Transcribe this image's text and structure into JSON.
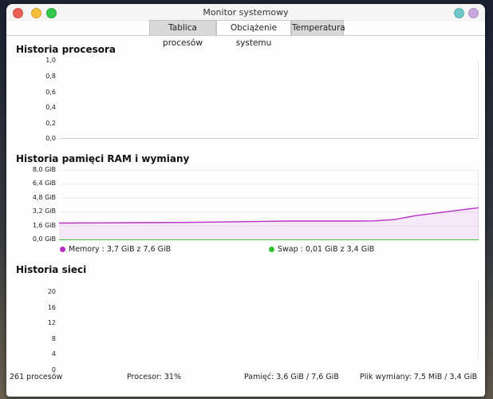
{
  "window": {
    "title": "Monitor systemowy",
    "controls_right": [
      {
        "name": "teal",
        "color": "#6cc7c9"
      },
      {
        "name": "purple",
        "color": "#c9a6db"
      }
    ]
  },
  "tabs": [
    {
      "label": "Tablica procesów",
      "active": false
    },
    {
      "label": "Obciążenie systemu",
      "active": true
    },
    {
      "label": "Temperatura",
      "active": false
    }
  ],
  "cpu": {
    "title": "Historia procesora",
    "ticks": [
      "1,0",
      "0,8",
      "0,6",
      "0,4",
      "0,2",
      "0,0"
    ]
  },
  "memory": {
    "title": "Historia pamięci RAM i wymiany",
    "ticks": [
      "8,0 GiB",
      "6,4 GiB",
      "4,8 GiB",
      "3,2 GiB",
      "1,6 GiB",
      "0,0 GiB"
    ],
    "legend": [
      {
        "label": "Memory : 3,7 GiB z 7,6 GiB",
        "color": "#b52fc2"
      },
      {
        "label": "Swap : 0,01 GiB z 3,4 GiB",
        "color": "#2ec22e"
      }
    ]
  },
  "network": {
    "title": "Historia sieci",
    "ticks": [
      "20",
      "16",
      "12",
      "8",
      "4",
      "0"
    ]
  },
  "status": {
    "processes": "261 procesów",
    "cpu": "Procesor: 31%",
    "memory": "Pamięć: 3,6 GiB / 7,6 GiB",
    "swap": "Plik wymiany: 7,5 MiB / 3,4 GiB"
  },
  "chart_data": [
    {
      "type": "line",
      "title": "Historia procesora",
      "ylim": [
        0,
        1.0
      ],
      "series": []
    },
    {
      "type": "area",
      "title": "Historia pamięci RAM i wymiany",
      "ylim": [
        0,
        8.0
      ],
      "x": [
        0,
        10,
        20,
        30,
        40,
        50,
        55,
        60,
        65,
        70,
        75,
        80,
        85,
        90,
        95,
        100
      ],
      "series": [
        {
          "name": "Memory",
          "color": "#b52fc2",
          "values": [
            1.95,
            1.97,
            2.0,
            2.03,
            2.08,
            2.15,
            2.18,
            2.18,
            2.18,
            2.18,
            2.2,
            2.35,
            2.8,
            3.1,
            3.4,
            3.7
          ]
        },
        {
          "name": "Swap",
          "color": "#2ec22e",
          "values": [
            0.01,
            0.01,
            0.01,
            0.01,
            0.01,
            0.01,
            0.01,
            0.01,
            0.01,
            0.01,
            0.01,
            0.01,
            0.01,
            0.01,
            0.01,
            0.01
          ]
        }
      ]
    },
    {
      "type": "line",
      "title": "Historia sieci",
      "ylim": [
        0,
        20
      ],
      "series": []
    }
  ]
}
